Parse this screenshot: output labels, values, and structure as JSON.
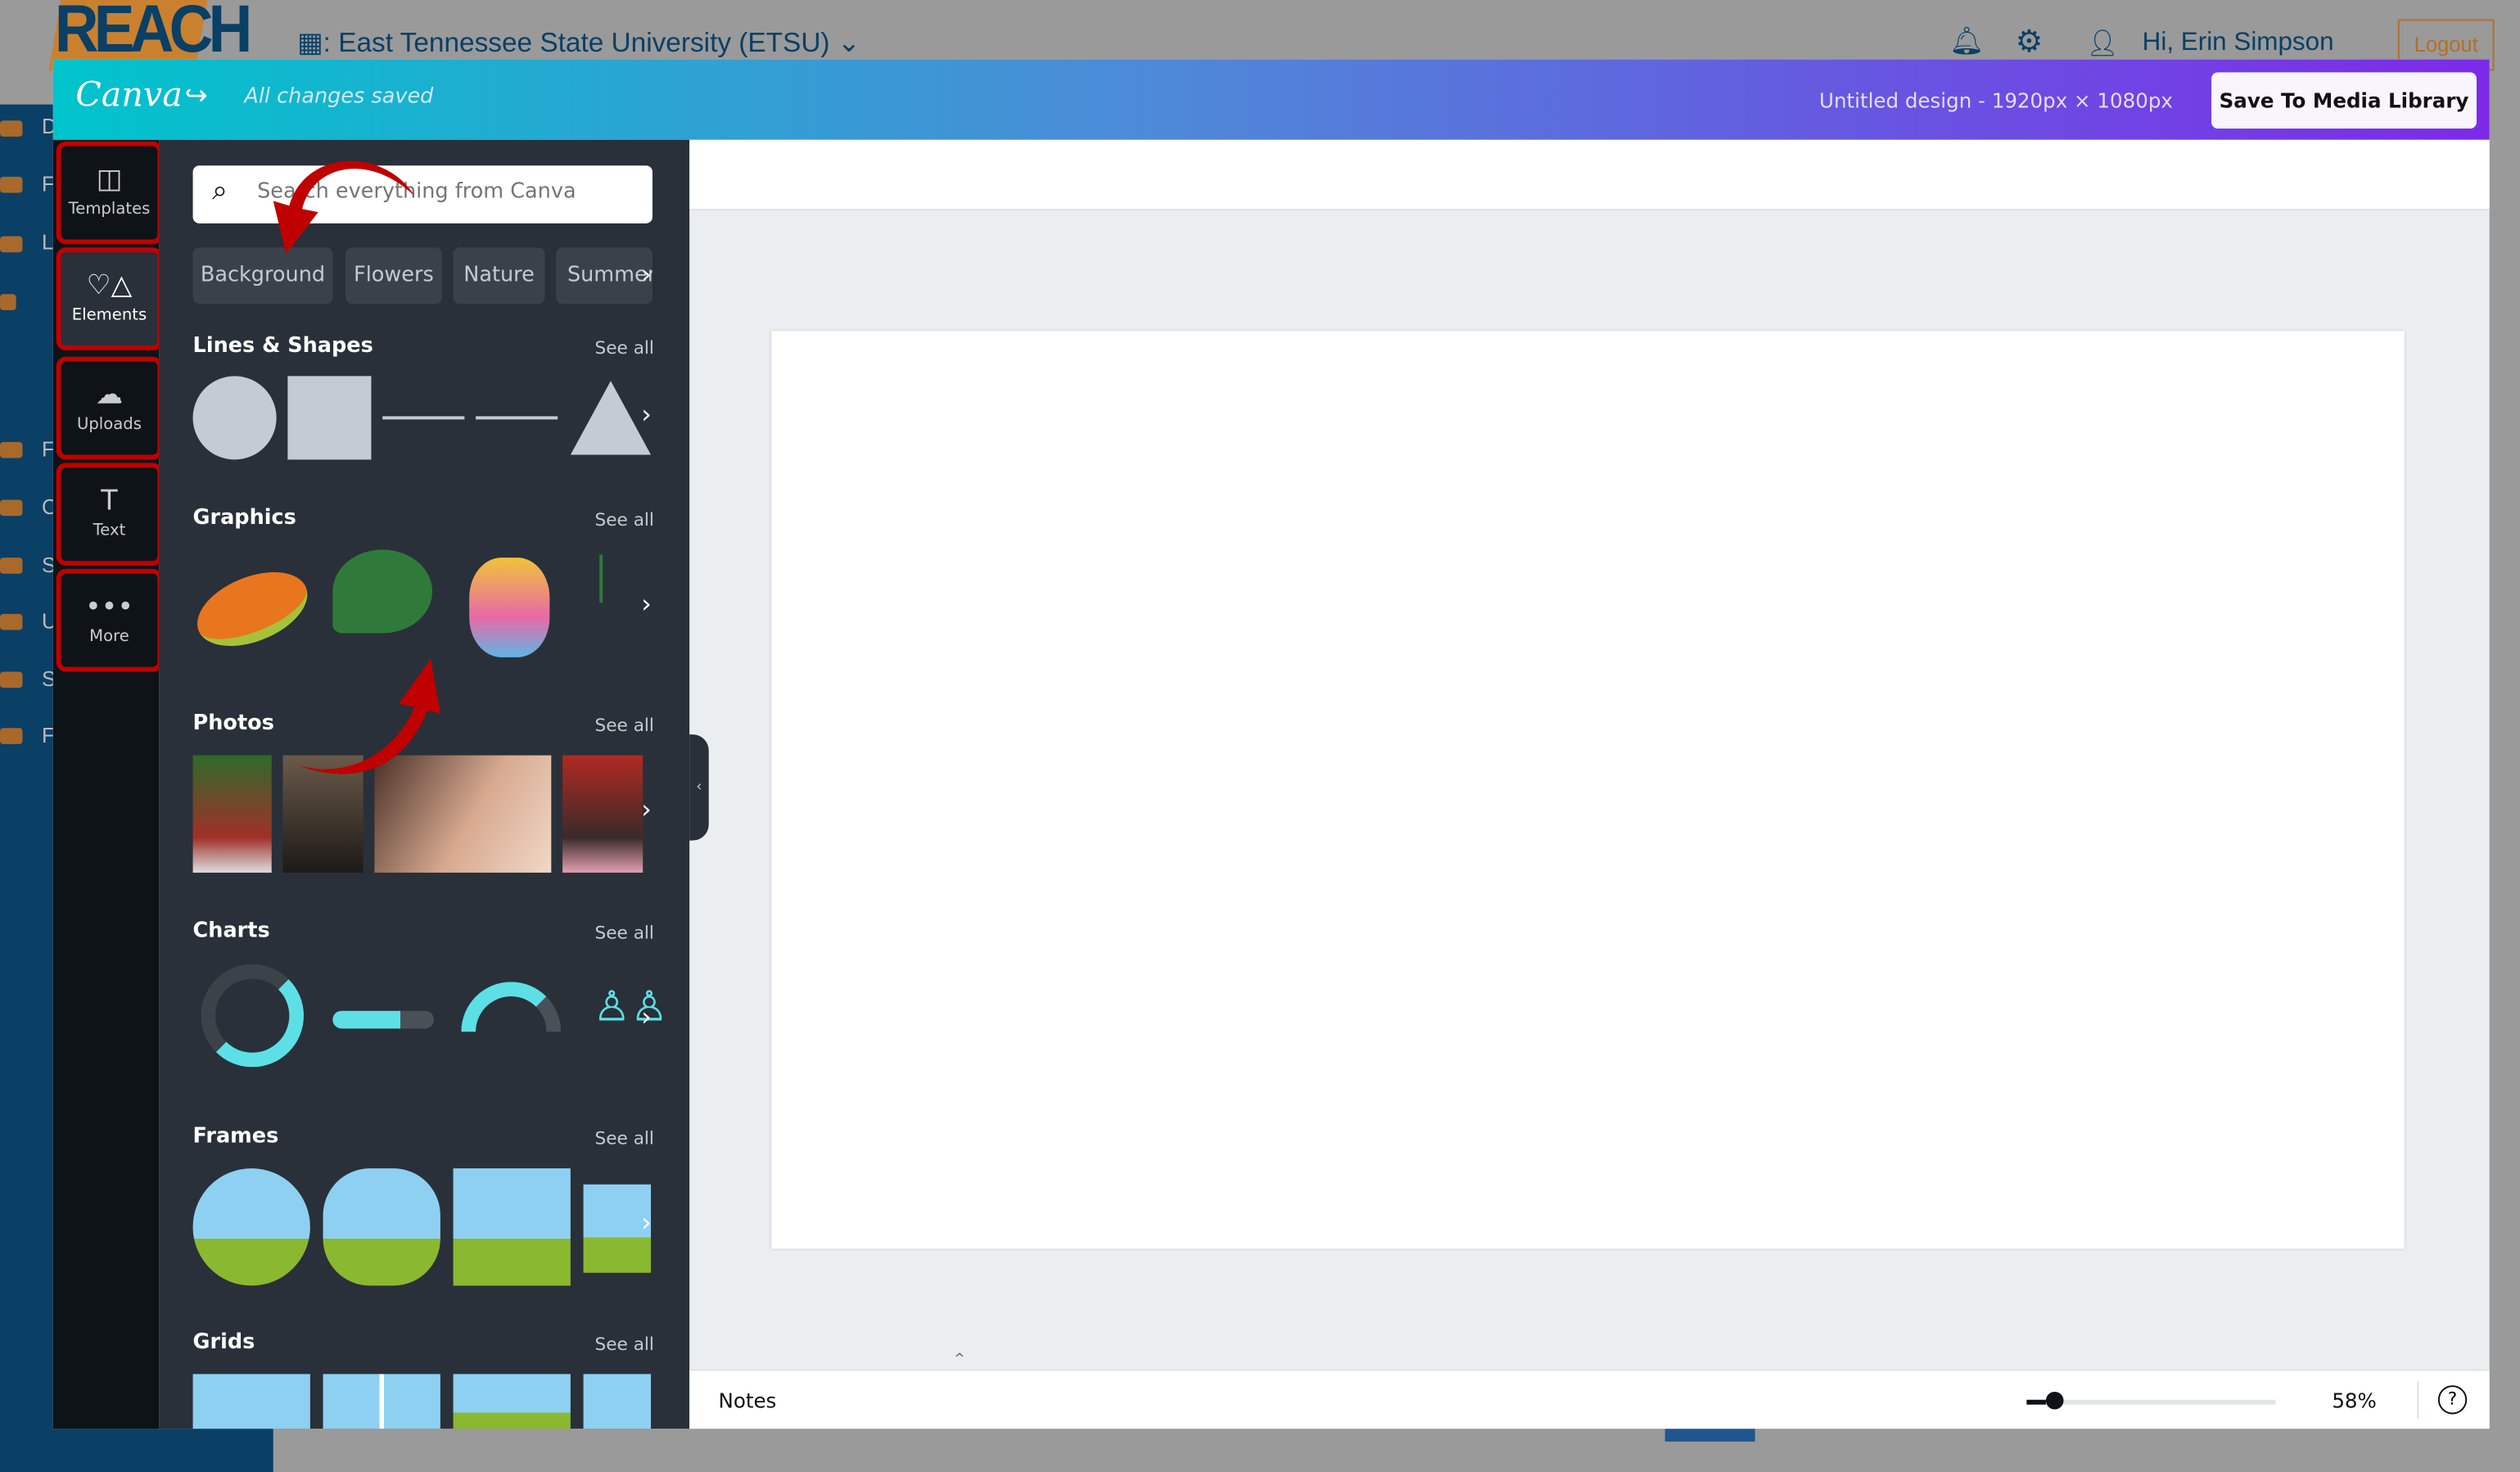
{
  "lms": {
    "logo_text": "REACH",
    "institution": ": East Tennessee State University (ETSU)",
    "greeting": "Hi, Erin Simpson",
    "logout_label": "Logout",
    "side_letters": [
      "D",
      "F",
      "L",
      "F",
      "C",
      "S",
      "U",
      "S",
      "F"
    ],
    "colors": {
      "navy": "#0a3f66",
      "orange": "#b0702a"
    }
  },
  "canva": {
    "logo": "Canva",
    "save_status": "All changes saved",
    "design_title": "Untitled design - 1920px × 1080px",
    "save_button": "Save To Media Library",
    "rail": [
      {
        "label": "Templates",
        "icon": "layout-icon"
      },
      {
        "label": "Elements",
        "icon": "shapes-icon"
      },
      {
        "label": "Uploads",
        "icon": "cloud-upload-icon"
      },
      {
        "label": "Text",
        "icon": "text-icon"
      },
      {
        "label": "More",
        "icon": "more-icon"
      }
    ],
    "search_placeholder": "Search everything from Canva",
    "chips": [
      "Background",
      "Flowers",
      "Nature",
      "Summer"
    ],
    "see_all": "See all",
    "sections": [
      "Lines & Shapes",
      "Graphics",
      "Photos",
      "Charts",
      "Frames",
      "Grids"
    ],
    "notes_label": "Notes",
    "zoom": "58%",
    "zoom_level": 0.05,
    "help": "?",
    "colors": {
      "gradient_start": "#00c4cc",
      "gradient_end": "#7d2ae8",
      "annotation_red": "#c00000"
    }
  }
}
